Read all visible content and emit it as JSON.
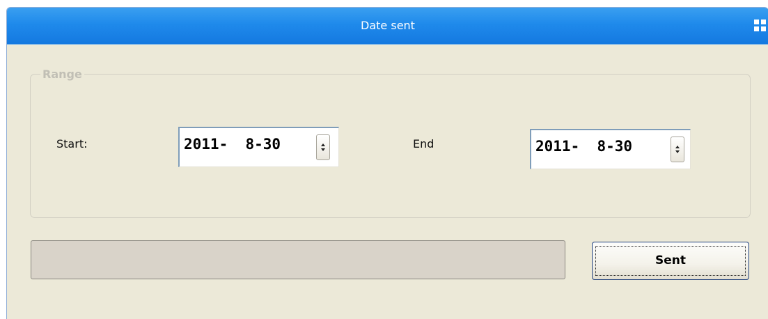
{
  "window": {
    "title": "Date sent",
    "title_icon": "grid-icon"
  },
  "range_group": {
    "legend": "Range",
    "start_label": "Start:",
    "start_date": "2011-  8-30",
    "end_label": "End",
    "end_date": "2011-  8-30"
  },
  "progress": {
    "value": 0
  },
  "send_button": {
    "label": "Sent"
  },
  "colors": {
    "titlebar": "#1f8aeb",
    "window_bg": "#ece9d8",
    "progress_track": "#d9d3c9",
    "button_border": "#1c3d7a"
  }
}
